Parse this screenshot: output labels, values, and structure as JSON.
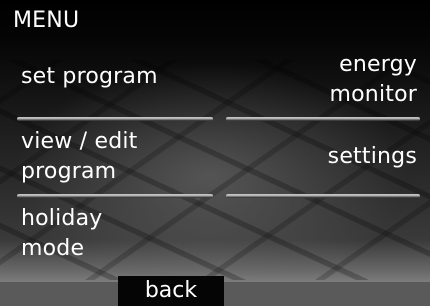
{
  "header": {
    "title": "MENU"
  },
  "menu": {
    "set_program": "set program",
    "energy_monitor_line1": "energy",
    "energy_monitor_line2": "monitor",
    "view_edit_line1": "view / edit",
    "view_edit_line2": "program",
    "settings": "settings",
    "holiday_line1": "holiday",
    "holiday_line2": "mode"
  },
  "footer": {
    "back_label": "back"
  }
}
